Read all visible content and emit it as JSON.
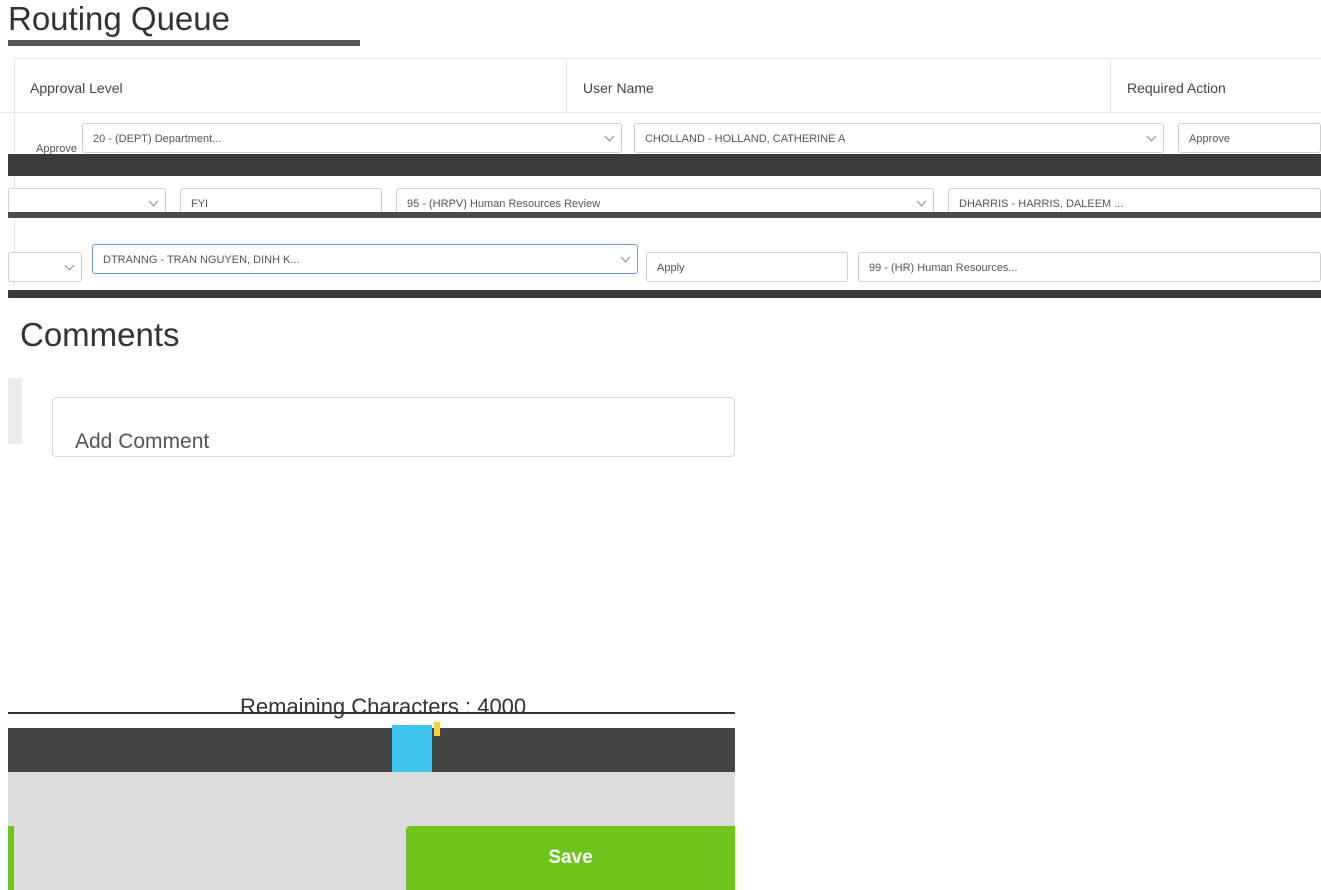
{
  "routing_queue": {
    "title": "Routing Queue",
    "columns": [
      "Approval Level",
      "User Name",
      "Required Action"
    ],
    "rows": [
      {
        "approval_level": "20 - (DEPT) Department...",
        "user_name": "CHOLLAND - HOLLAND, CATHERINE A",
        "required_action": "Approve"
      },
      {
        "approval_level": "95 - (HRPV) Human Resources Review",
        "user_name": "DHARRIS - HARRIS, DALEEM ...",
        "required_action": "FYI"
      },
      {
        "approval_level": "99 - (HR) Human Resources...",
        "user_name": "DTRANNG - TRAN NGUYEN, DINH K...",
        "required_action": "Apply"
      }
    ],
    "row_label": "Approve"
  },
  "comments": {
    "title": "Comments",
    "placeholder": "Add Comment",
    "remaining": "Remaining Characters : 4000"
  },
  "actions": {
    "save_label": "Save"
  },
  "colors": {
    "save_green": "#6ec41b",
    "dark_bar": "#444444",
    "footer_gray": "#dcdcdc"
  }
}
